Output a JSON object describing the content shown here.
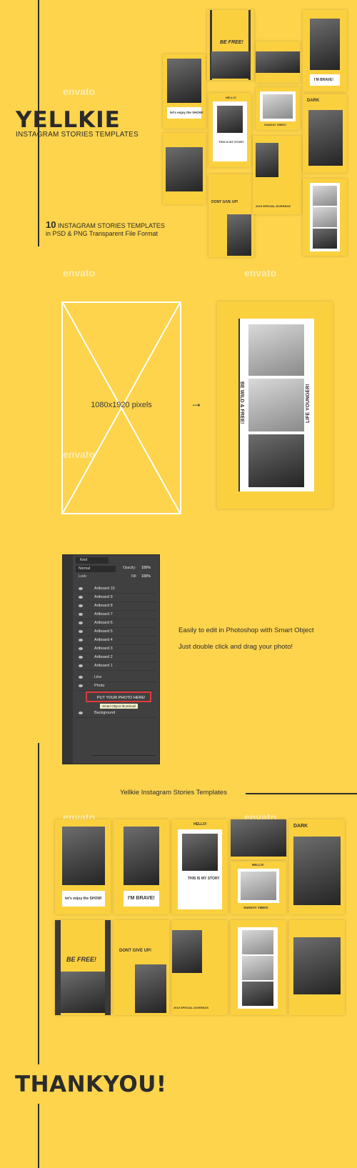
{
  "brand": {
    "title": "YELLKIE",
    "subtitle": "INSTAGRAM STORIES TEMPLATES"
  },
  "promo": {
    "count": "10",
    "count_label": "INSTAGRAM STORIES TEMPLATES",
    "format_line": "in PSD & PNG Transparent File Format"
  },
  "watermark": "envato",
  "template_spec": {
    "dimensions": "1080x1920 pixels",
    "arrow": "→"
  },
  "sample_story": {
    "left_text": "BE WILD & FREE!",
    "right_text": "LIFE YOUNGER!"
  },
  "photoshop": {
    "search_kind": "Kind",
    "blend_mode": "Normal",
    "opacity_label": "Opacity:",
    "opacity_value": "100%",
    "lock_label": "Lock:",
    "fill_label": "Fill:",
    "fill_value": "100%",
    "layers": [
      "Artboard 10",
      "Artboard 9",
      "Artboard 8",
      "Artboard 7",
      "Artboard 6",
      "Artboard 5",
      "Artboard 4",
      "Artboard 3",
      "Artboard 2",
      "Artboard 1",
      "Line",
      "Photo"
    ],
    "highlight_layer": "PUT YOUR PHOTO HERE!",
    "tooltip": "Smart Object thumbnail",
    "bottom_layer": "Background"
  },
  "notes": {
    "line1": "Easily to edit in Photoshop with Smart Object",
    "line2": "Just double click and drag your photo!"
  },
  "section_title": "Yellkie Instagram Stories Templates",
  "card_texts": {
    "be_free": "BE FREE!",
    "brave": "I'M BRAVE!",
    "hello": "HELLO!",
    "story": "THIS IS MY STORY",
    "sunday": "SUNDAY VIBES!",
    "dark": "DARK",
    "dont_give_up": "DONT GIVE UP!",
    "show": "let's enjoy the SHOW!",
    "diversos": "2019 SPECIAL DIVERSOS"
  },
  "closing": "THANKYOU!",
  "colors": {
    "background": "#fdd44c",
    "accent_dark": "#2e2e2e",
    "highlight": "#e03a3a"
  }
}
